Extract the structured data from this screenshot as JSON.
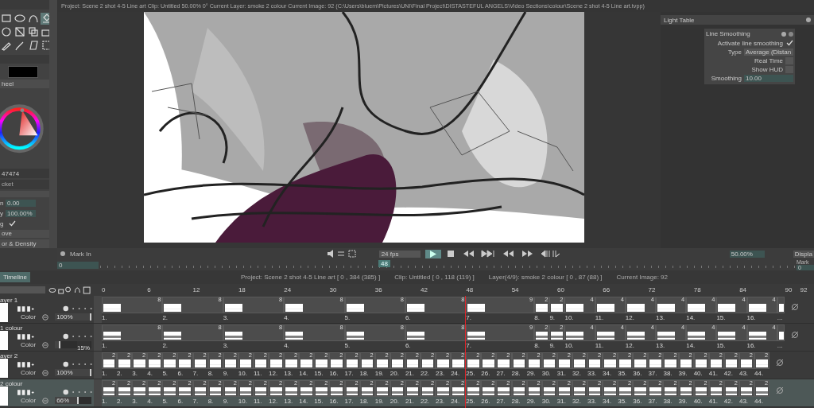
{
  "title_bar": {
    "text": "Project:  Scene 2 shot 4-5 Line art   Clip:  Untitled   50.00%   0°   Current Layer:  smoke 2 colour   Current Image: 92 (C:\\Users\\bluem\\Pictures\\UNI\\Final Project\\DISTASTEFUL ANGELS\\Video Sections\\colour\\Scene 2 shot 4-5 Line art.tvpp)"
  },
  "left_panel": {
    "tools": [
      {
        "kind": "rect",
        "selected": false
      },
      {
        "kind": "ellipse",
        "selected": false
      },
      {
        "kind": "curve",
        "selected": false
      },
      {
        "kind": "fill",
        "selected": true
      },
      {
        "kind": "circle",
        "selected": false
      },
      {
        "kind": "warp",
        "selected": false
      },
      {
        "kind": "layers",
        "selected": false
      },
      {
        "kind": "camera",
        "selected": false
      },
      {
        "kind": "brush",
        "selected": false
      },
      {
        "kind": "pen",
        "selected": false
      },
      {
        "kind": "paper",
        "selected": false
      },
      {
        "kind": "select",
        "selected": false
      }
    ],
    "color_mode": "heel",
    "hex": "47474",
    "brush_panel": {
      "title": "cket",
      "fields": [
        {
          "label": "n",
          "value": "0.00"
        },
        {
          "label": "y",
          "value": "100.00%"
        }
      ],
      "check": {
        "label": "g",
        "checked": true
      },
      "dropdowns": [
        "ove",
        "or & Density"
      ]
    }
  },
  "right_panel": {
    "light_table": "Light Table",
    "line_smoothing": {
      "title": "Line Smoothing",
      "activate": {
        "label": "Activate line smoothing",
        "checked": true
      },
      "type": {
        "label": "Type",
        "value": "Average (Distan"
      },
      "options": [
        {
          "label": "Real Time",
          "checked": false
        },
        {
          "label": "Show HUD",
          "checked": false
        }
      ],
      "smoothing": {
        "label": "Smoothing",
        "value": "10.00"
      }
    }
  },
  "playback": {
    "mark_in": "Mark In",
    "mark_in_value": "0",
    "fps": "24 fps",
    "position_label": "48",
    "zoom": "50.00%",
    "display": "Displa",
    "mark_out": "Mark",
    "mark_out_value": "0"
  },
  "timeline": {
    "tab": "Timeline",
    "info": [
      "Project: Scene 2 shot 4-5 Line art [ 0 , 384  (385) ]",
      "Clip: Untitled [ 0 , 118  (119) ]",
      "Layer(4/9): smoke 2 colour  [ 0 , 87  (88) ]",
      "Current Image: 92"
    ],
    "ruler": [
      "0",
      "6",
      "12",
      "18",
      "24",
      "30",
      "36",
      "42",
      "48",
      "54",
      "60",
      "66",
      "72",
      "78",
      "84",
      "90",
      "92"
    ],
    "layers": [
      {
        "name": "ayer 1",
        "kind": "line",
        "selected": false,
        "blend": "Color",
        "opacity": "100%",
        "level": 1,
        "more": "...",
        "instances": [
          {
            "label": "1.",
            "duration": "8"
          },
          {
            "label": "2.",
            "duration": "8"
          },
          {
            "label": "3.",
            "duration": "8"
          },
          {
            "label": "4.",
            "duration": "8"
          },
          {
            "label": "5.",
            "duration": "8"
          },
          {
            "label": "6.",
            "duration": "8"
          },
          {
            "label": "7.",
            "duration": "9"
          },
          {
            "label": "8.",
            "duration": "2"
          },
          {
            "label": "9.",
            "duration": "2"
          },
          {
            "label": "10.",
            "duration": "4"
          },
          {
            "label": "11.",
            "duration": "4"
          },
          {
            "label": "12.",
            "duration": "4"
          },
          {
            "label": "13.",
            "duration": "4"
          },
          {
            "label": "14.",
            "duration": "4"
          },
          {
            "label": "15.",
            "duration": "4"
          },
          {
            "label": "16.",
            "duration": "4"
          }
        ]
      },
      {
        "name": "1 colour",
        "kind": "colour",
        "selected": false,
        "blend": "Color",
        "opacity": "15%",
        "level": 0.15,
        "more": "...",
        "instances": [
          {
            "label": "1.",
            "duration": "8"
          },
          {
            "label": "2.",
            "duration": "8"
          },
          {
            "label": "3.",
            "duration": "8"
          },
          {
            "label": "4.",
            "duration": "8"
          },
          {
            "label": "5.",
            "duration": "8"
          },
          {
            "label": "6.",
            "duration": "8"
          },
          {
            "label": "7.",
            "duration": "9"
          },
          {
            "label": "8.",
            "duration": "2"
          },
          {
            "label": "9.",
            "duration": "2"
          },
          {
            "label": "10.",
            "duration": "4"
          },
          {
            "label": "11.",
            "duration": "4"
          },
          {
            "label": "12.",
            "duration": "4"
          },
          {
            "label": "13.",
            "duration": "4"
          },
          {
            "label": "14.",
            "duration": "4"
          },
          {
            "label": "15.",
            "duration": "4"
          },
          {
            "label": "16.",
            "duration": "4"
          }
        ]
      },
      {
        "name": "ayer 2",
        "kind": "line",
        "selected": false,
        "blend": "Color",
        "opacity": "100%",
        "level": 1,
        "instances": [
          {
            "label": "1.",
            "duration": "2"
          },
          {
            "label": "2.",
            "duration": "2"
          },
          {
            "label": "3.",
            "duration": "2"
          },
          {
            "label": "4.",
            "duration": "2"
          },
          {
            "label": "5.",
            "duration": "2"
          },
          {
            "label": "6.",
            "duration": "2"
          },
          {
            "label": "7.",
            "duration": "2"
          },
          {
            "label": "8.",
            "duration": "2"
          },
          {
            "label": "9.",
            "duration": "2"
          },
          {
            "label": "10.",
            "duration": "2"
          },
          {
            "label": "11.",
            "duration": "2"
          },
          {
            "label": "12.",
            "duration": "2"
          },
          {
            "label": "13.",
            "duration": "2"
          },
          {
            "label": "14.",
            "duration": "2"
          },
          {
            "label": "15.",
            "duration": "2"
          },
          {
            "label": "16.",
            "duration": "2"
          },
          {
            "label": "17.",
            "duration": "2"
          },
          {
            "label": "18.",
            "duration": "2"
          },
          {
            "label": "19.",
            "duration": "2"
          },
          {
            "label": "20.",
            "duration": "2"
          },
          {
            "label": "21.",
            "duration": "2"
          },
          {
            "label": "22.",
            "duration": "2"
          },
          {
            "label": "23.",
            "duration": "2"
          },
          {
            "label": "24.",
            "duration": "2"
          },
          {
            "label": "25.",
            "duration": "2"
          },
          {
            "label": "26.",
            "duration": "2"
          },
          {
            "label": "27.",
            "duration": "2"
          },
          {
            "label": "28.",
            "duration": "2"
          },
          {
            "label": "29.",
            "duration": "2"
          },
          {
            "label": "30.",
            "duration": "2"
          },
          {
            "label": "31.",
            "duration": "2"
          },
          {
            "label": "32.",
            "duration": "2"
          },
          {
            "label": "33.",
            "duration": "2"
          },
          {
            "label": "34.",
            "duration": "2"
          },
          {
            "label": "35.",
            "duration": "2"
          },
          {
            "label": "36.",
            "duration": "2"
          },
          {
            "label": "37.",
            "duration": "2"
          },
          {
            "label": "38.",
            "duration": "2"
          },
          {
            "label": "39.",
            "duration": "2"
          },
          {
            "label": "40.",
            "duration": "2"
          },
          {
            "label": "41.",
            "duration": "2"
          },
          {
            "label": "42.",
            "duration": "2"
          },
          {
            "label": "43.",
            "duration": "2"
          },
          {
            "label": "44.",
            "duration": "2"
          }
        ]
      },
      {
        "name": "2 colour",
        "kind": "colour",
        "selected": true,
        "blend": "Color",
        "opacity": "66%",
        "level": 0.66,
        "instances": [
          {
            "label": "1.",
            "duration": "2"
          },
          {
            "label": "2.",
            "duration": "2"
          },
          {
            "label": "3.",
            "duration": "2"
          },
          {
            "label": "4.",
            "duration": "2"
          },
          {
            "label": "5.",
            "duration": "2"
          },
          {
            "label": "6.",
            "duration": "2"
          },
          {
            "label": "7.",
            "duration": "2"
          },
          {
            "label": "8.",
            "duration": "2"
          },
          {
            "label": "9.",
            "duration": "2"
          },
          {
            "label": "10.",
            "duration": "2"
          },
          {
            "label": "11.",
            "duration": "2"
          },
          {
            "label": "12.",
            "duration": "2"
          },
          {
            "label": "13.",
            "duration": "2"
          },
          {
            "label": "14.",
            "duration": "2"
          },
          {
            "label": "15.",
            "duration": "2"
          },
          {
            "label": "16.",
            "duration": "2"
          },
          {
            "label": "17.",
            "duration": "2"
          },
          {
            "label": "18.",
            "duration": "2"
          },
          {
            "label": "19.",
            "duration": "2"
          },
          {
            "label": "20.",
            "duration": "2"
          },
          {
            "label": "21.",
            "duration": "2"
          },
          {
            "label": "22.",
            "duration": "2"
          },
          {
            "label": "23.",
            "duration": "2"
          },
          {
            "label": "24.",
            "duration": "2"
          },
          {
            "label": "25.",
            "duration": "2"
          },
          {
            "label": "26.",
            "duration": "2"
          },
          {
            "label": "27.",
            "duration": "2"
          },
          {
            "label": "28.",
            "duration": "2"
          },
          {
            "label": "29.",
            "duration": "2"
          },
          {
            "label": "30.",
            "duration": "2"
          },
          {
            "label": "31.",
            "duration": "2"
          },
          {
            "label": "32.",
            "duration": "2"
          },
          {
            "label": "33.",
            "duration": "2"
          },
          {
            "label": "34.",
            "duration": "2"
          },
          {
            "label": "35.",
            "duration": "2"
          },
          {
            "label": "36.",
            "duration": "2"
          },
          {
            "label": "37.",
            "duration": "2"
          },
          {
            "label": "38.",
            "duration": "2"
          },
          {
            "label": "39.",
            "duration": "2"
          },
          {
            "label": "40.",
            "duration": "2"
          },
          {
            "label": "41.",
            "duration": "2"
          },
          {
            "label": "42.",
            "duration": "2"
          },
          {
            "label": "43.",
            "duration": "2"
          },
          {
            "label": "44.",
            "duration": "2"
          }
        ]
      }
    ]
  }
}
